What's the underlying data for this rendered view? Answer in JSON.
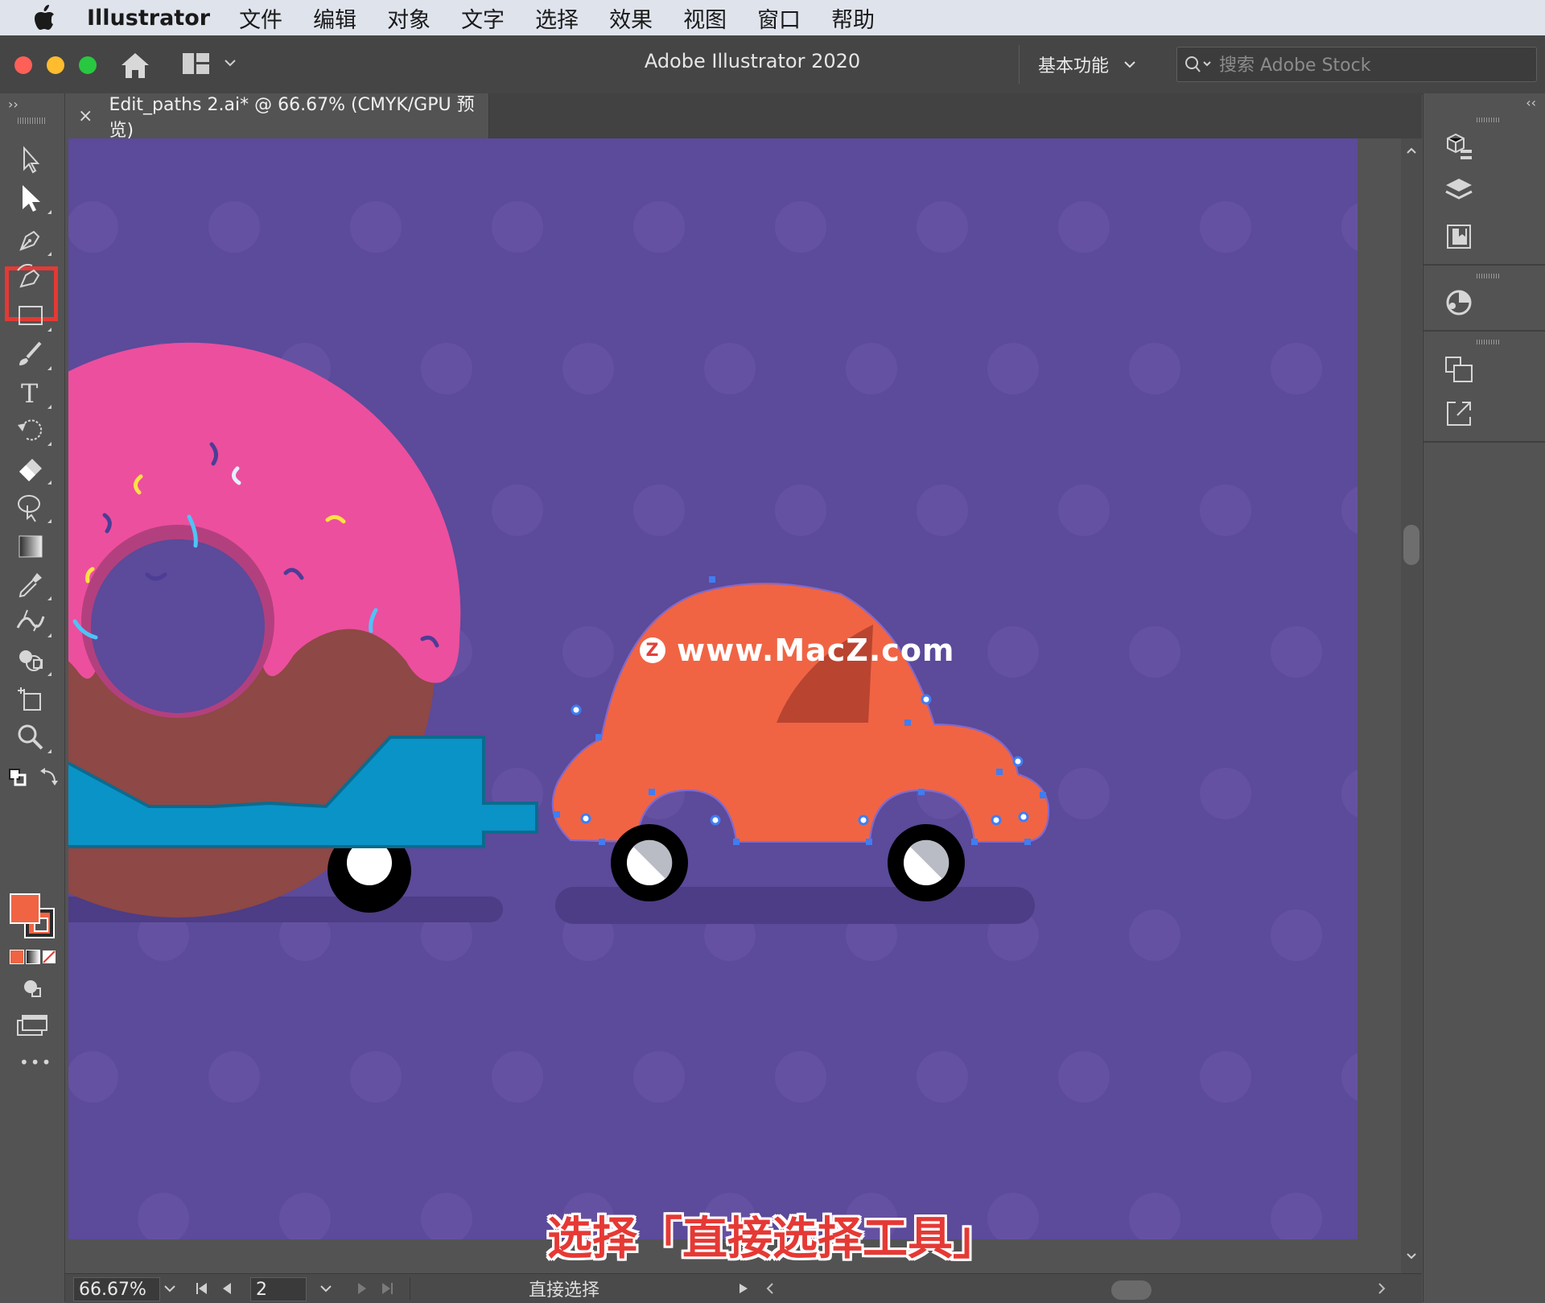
{
  "menubar": {
    "app_name": "Illustrator",
    "items": [
      "文件",
      "编辑",
      "对象",
      "文字",
      "选择",
      "效果",
      "视图",
      "窗口",
      "帮助"
    ]
  },
  "appbar": {
    "title": "Adobe Illustrator 2020",
    "workspace_label": "基本功能",
    "search_placeholder": "搜索 Adobe Stock"
  },
  "document": {
    "tab_label": "Edit_paths 2.ai* @ 66.67% (CMYK/GPU 预览)",
    "close_glyph": "×"
  },
  "toolbar": {
    "collapse_glyph": "››",
    "active_tool": "direct-selection-tool",
    "tools": [
      "selection-tool",
      "direct-selection-tool",
      "pen-tool",
      "curvature-tool",
      "rectangle-tool",
      "paintbrush-tool",
      "type-tool",
      "rotate-tool",
      "eraser-tool",
      "puppet-warp-tool",
      "gradient-tool",
      "eyedropper-tool",
      "width-tool",
      "shape-builder-tool",
      "artboard-tool",
      "zoom-tool"
    ],
    "type_glyph": "T",
    "more_glyph": "•••",
    "fill_color": "#f06444",
    "stroke_color": "#f06444"
  },
  "status": {
    "zoom": "66.67%",
    "artboard_number": "2",
    "current_tool": "直接选择"
  },
  "right_dock": {
    "collapse_glyph": "‹‹"
  },
  "overlay": {
    "watermark_logo": "Z",
    "watermark": "www.MacZ.com",
    "caption": "选择「直接选择工具」"
  },
  "colors": {
    "artboard": "#5c4a9a",
    "car_body": "#f06444",
    "car_window": "#b94430",
    "donut_icing": "#ec4f9e",
    "donut_dough": "#8e4845",
    "trailer": "#0a93c7",
    "selection": "#3f7df2",
    "highlight": "#e53935"
  }
}
